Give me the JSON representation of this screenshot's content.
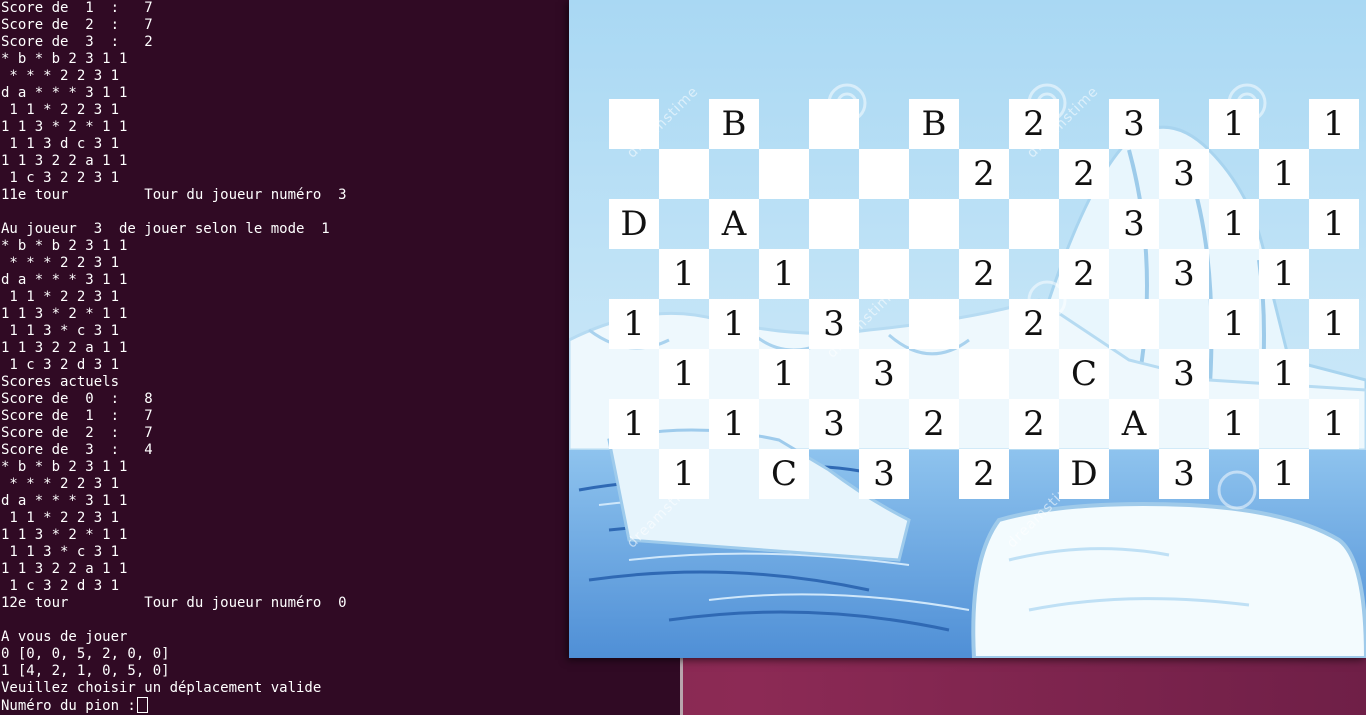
{
  "terminal": {
    "lines": [
      "Score de  1  :   7",
      "Score de  2  :   7",
      "Score de  3  :   2",
      "* b * b 2 3 1 1",
      " * * * 2 2 3 1",
      "d a * * * 3 1 1",
      " 1 1 * 2 2 3 1",
      "1 1 3 * 2 * 1 1",
      " 1 1 3 d c 3 1",
      "1 1 3 2 2 a 1 1",
      " 1 c 3 2 2 3 1",
      "11e tour         Tour du joueur numéro  3",
      "",
      "Au joueur  3  de jouer selon le mode  1",
      "* b * b 2 3 1 1",
      " * * * 2 2 3 1",
      "d a * * * 3 1 1",
      " 1 1 * 2 2 3 1",
      "1 1 3 * 2 * 1 1",
      " 1 1 3 * c 3 1",
      "1 1 3 2 2 a 1 1",
      " 1 c 3 2 d 3 1",
      "Scores actuels",
      "Score de  0  :   8",
      "Score de  1  :   7",
      "Score de  2  :   7",
      "Score de  3  :   4",
      "* b * b 2 3 1 1",
      " * * * 2 2 3 1",
      "d a * * * 3 1 1",
      " 1 1 * 2 2 3 1",
      "1 1 3 * 2 * 1 1",
      " 1 1 3 * c 3 1",
      "1 1 3 2 2 a 1 1",
      " 1 c 3 2 d 3 1",
      "12e tour         Tour du joueur numéro  0",
      "",
      "A vous de jouer",
      "0 [0, 0, 5, 2, 0, 0]",
      "1 [4, 2, 1, 0, 5, 0]",
      "Veuillez choisir un déplacement valide"
    ],
    "prompt": "Numéro du pion :"
  },
  "game": {
    "watermark": "dreamstime",
    "board": [
      [
        "",
        "B",
        "",
        "B",
        "2",
        "3",
        "1",
        "1"
      ],
      [
        "",
        "",
        "",
        "2",
        "2",
        "3",
        "1",
        ""
      ],
      [
        "D",
        "A",
        "",
        "",
        "",
        "3",
        "1",
        "1"
      ],
      [
        "1",
        "1",
        "",
        "2",
        "2",
        "3",
        "1",
        ""
      ],
      [
        "1",
        "1",
        "3",
        "",
        "2",
        "",
        "1",
        "1"
      ],
      [
        "1",
        "1",
        "3",
        "",
        "C",
        "3",
        "1",
        ""
      ],
      [
        "1",
        "1",
        "3",
        "2",
        "2",
        "A",
        "1",
        "1"
      ],
      [
        "1",
        "C",
        "3",
        "2",
        "D",
        "3",
        "1",
        ""
      ]
    ]
  },
  "colors": {
    "terminal_bg": "#300a24",
    "terminal_fg": "#ffffff",
    "sky": "#bfe3f7",
    "water": "#5c9ee0"
  }
}
